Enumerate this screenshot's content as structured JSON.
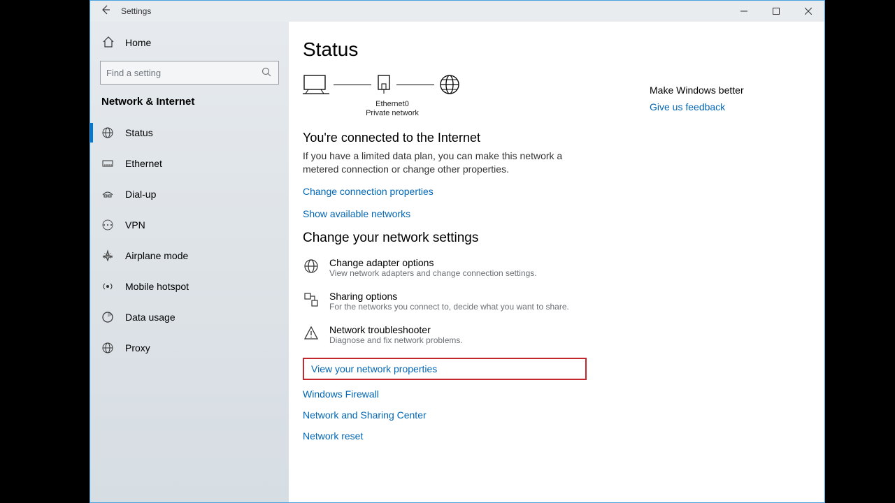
{
  "window": {
    "title": "Settings"
  },
  "sidebar": {
    "home": "Home",
    "search_placeholder": "Find a setting",
    "section": "Network & Internet",
    "items": [
      {
        "label": "Status"
      },
      {
        "label": "Ethernet"
      },
      {
        "label": "Dial-up"
      },
      {
        "label": "VPN"
      },
      {
        "label": "Airplane mode"
      },
      {
        "label": "Mobile hotspot"
      },
      {
        "label": "Data usage"
      },
      {
        "label": "Proxy"
      }
    ]
  },
  "main": {
    "page_title": "Status",
    "diagram": {
      "device": "Ethernet0",
      "network_type": "Private network"
    },
    "connected_heading": "You're connected to the Internet",
    "connected_body": "If you have a limited data plan, you can make this network a metered connection or change other properties.",
    "link_change_props": "Change connection properties",
    "link_show_networks": "Show available networks",
    "change_settings_heading": "Change your network settings",
    "options": [
      {
        "title": "Change adapter options",
        "desc": "View network adapters and change connection settings."
      },
      {
        "title": "Sharing options",
        "desc": "For the networks you connect to, decide what you want to share."
      },
      {
        "title": "Network troubleshooter",
        "desc": "Diagnose and fix network problems."
      }
    ],
    "links": [
      "View your network properties",
      "Windows Firewall",
      "Network and Sharing Center",
      "Network reset"
    ]
  },
  "right": {
    "heading": "Make Windows better",
    "link": "Give us feedback"
  }
}
